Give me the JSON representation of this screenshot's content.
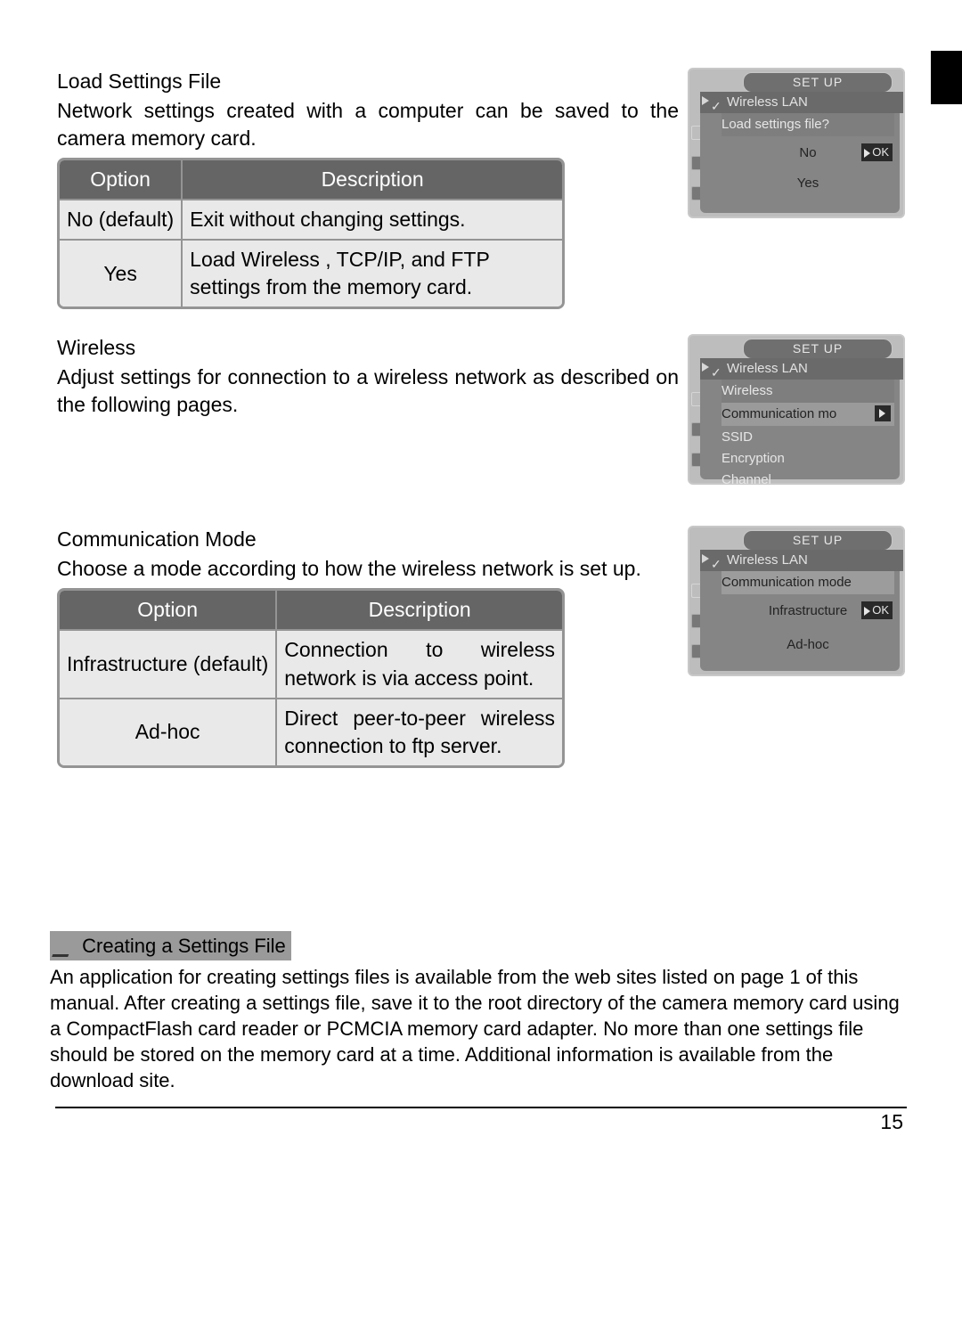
{
  "section1": {
    "heading": "Load Settings File",
    "paragraph": "Network settings created with a computer can be saved to the camera memory card.",
    "table": {
      "headers": [
        "Option",
        "Description"
      ],
      "rows": [
        {
          "opt": "No (default)",
          "desc": "Exit without changing settings."
        },
        {
          "opt": "Yes",
          "desc": "Load Wireless , TCP/IP, and FTP settings from the memory card."
        }
      ]
    },
    "menu": {
      "tab": "SET  UP",
      "header": "Wireless LAN",
      "subtitle": "Load settings file?",
      "items": [
        {
          "label": "No",
          "selected": true,
          "ok": "OK",
          "center": true
        },
        {
          "label": "Yes",
          "center": true
        }
      ]
    }
  },
  "section2": {
    "heading": "Wireless",
    "paragraph": "Adjust settings for connection to a wireless network as described on the following pages.",
    "menu": {
      "tab": "SET  UP",
      "header": "Wireless LAN",
      "subtitle": "Wireless",
      "items": [
        {
          "label": "Communication mo",
          "light": true,
          "arrow": true
        },
        {
          "label": "SSID",
          "light": true
        },
        {
          "label": "Encryption",
          "light": true
        },
        {
          "label": "Channel",
          "light": true
        }
      ]
    }
  },
  "section3": {
    "heading": "Communication Mode",
    "paragraph": "Choose a mode according to how the wireless net­work is set up.",
    "table": {
      "headers": [
        "Option",
        "Description"
      ],
      "rows": [
        {
          "opt": "Infrastructure (default)",
          "desc": "Connection to wireless network is via ac­cess point."
        },
        {
          "opt": "Ad-hoc",
          "desc": "Direct peer-to-peer wireless connection to ftp server."
        }
      ]
    },
    "menu": {
      "tab": "SET  UP",
      "header": "Wireless LAN",
      "subtitle": "Communication mode",
      "items": [
        {
          "label": "Infrastructure",
          "selected": true,
          "ok": "OK",
          "center": true
        },
        {
          "label": "Ad-hoc",
          "center": true
        }
      ]
    }
  },
  "footnote": {
    "title": "Creating a Settings File",
    "body": "An application for creating settings ﬁles is available from the web sites listed on page 1 of this manual.  After creating a settings ﬁle, save it to the root directory of the camera memory card using a CompactFlash card reader or PCMCIA memory card adapter.  No more than one settings ﬁle should be stored on the memory card at a time.  Additional information is available from the download site."
  },
  "page_number": "15"
}
